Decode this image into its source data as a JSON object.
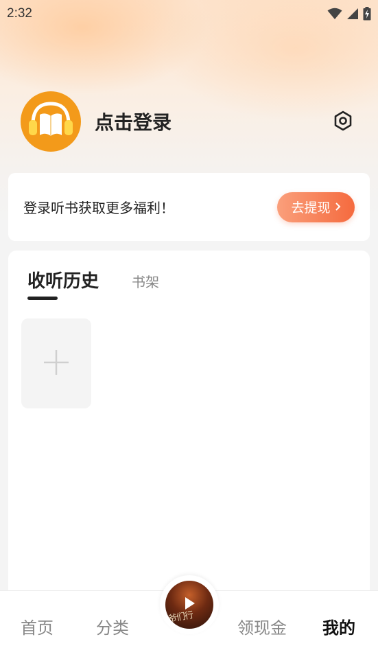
{
  "status_bar": {
    "time": "2:32",
    "icons": [
      "wifi-icon",
      "signal-icon",
      "battery-charging-icon"
    ]
  },
  "profile": {
    "avatar_icon": "headphones-book-icon",
    "login_label": "点击登录",
    "settings_icon": "settings-hex-icon"
  },
  "promo": {
    "text": "登录听书获取更多福利！",
    "button_label": "去提现",
    "button_icon": "chevron-right-icon"
  },
  "history": {
    "tabs": [
      {
        "label": "收听历史",
        "active": true
      },
      {
        "label": "书架",
        "active": false
      }
    ],
    "add_icon": "plus-icon"
  },
  "bottom_nav": {
    "items": [
      {
        "label": "首页",
        "active": false
      },
      {
        "label": "分类",
        "active": false
      },
      {
        "label": "领现金",
        "active": false
      },
      {
        "label": "我的",
        "active": true
      }
    ],
    "player": {
      "disc_text": "爷们行",
      "play_icon": "play-icon"
    }
  },
  "colors": {
    "accent_orange": "#f39a1a",
    "button_gradient_start": "#fa9f7b",
    "button_gradient_end": "#f56a3e",
    "text_primary": "#222222",
    "text_secondary": "#888888"
  }
}
